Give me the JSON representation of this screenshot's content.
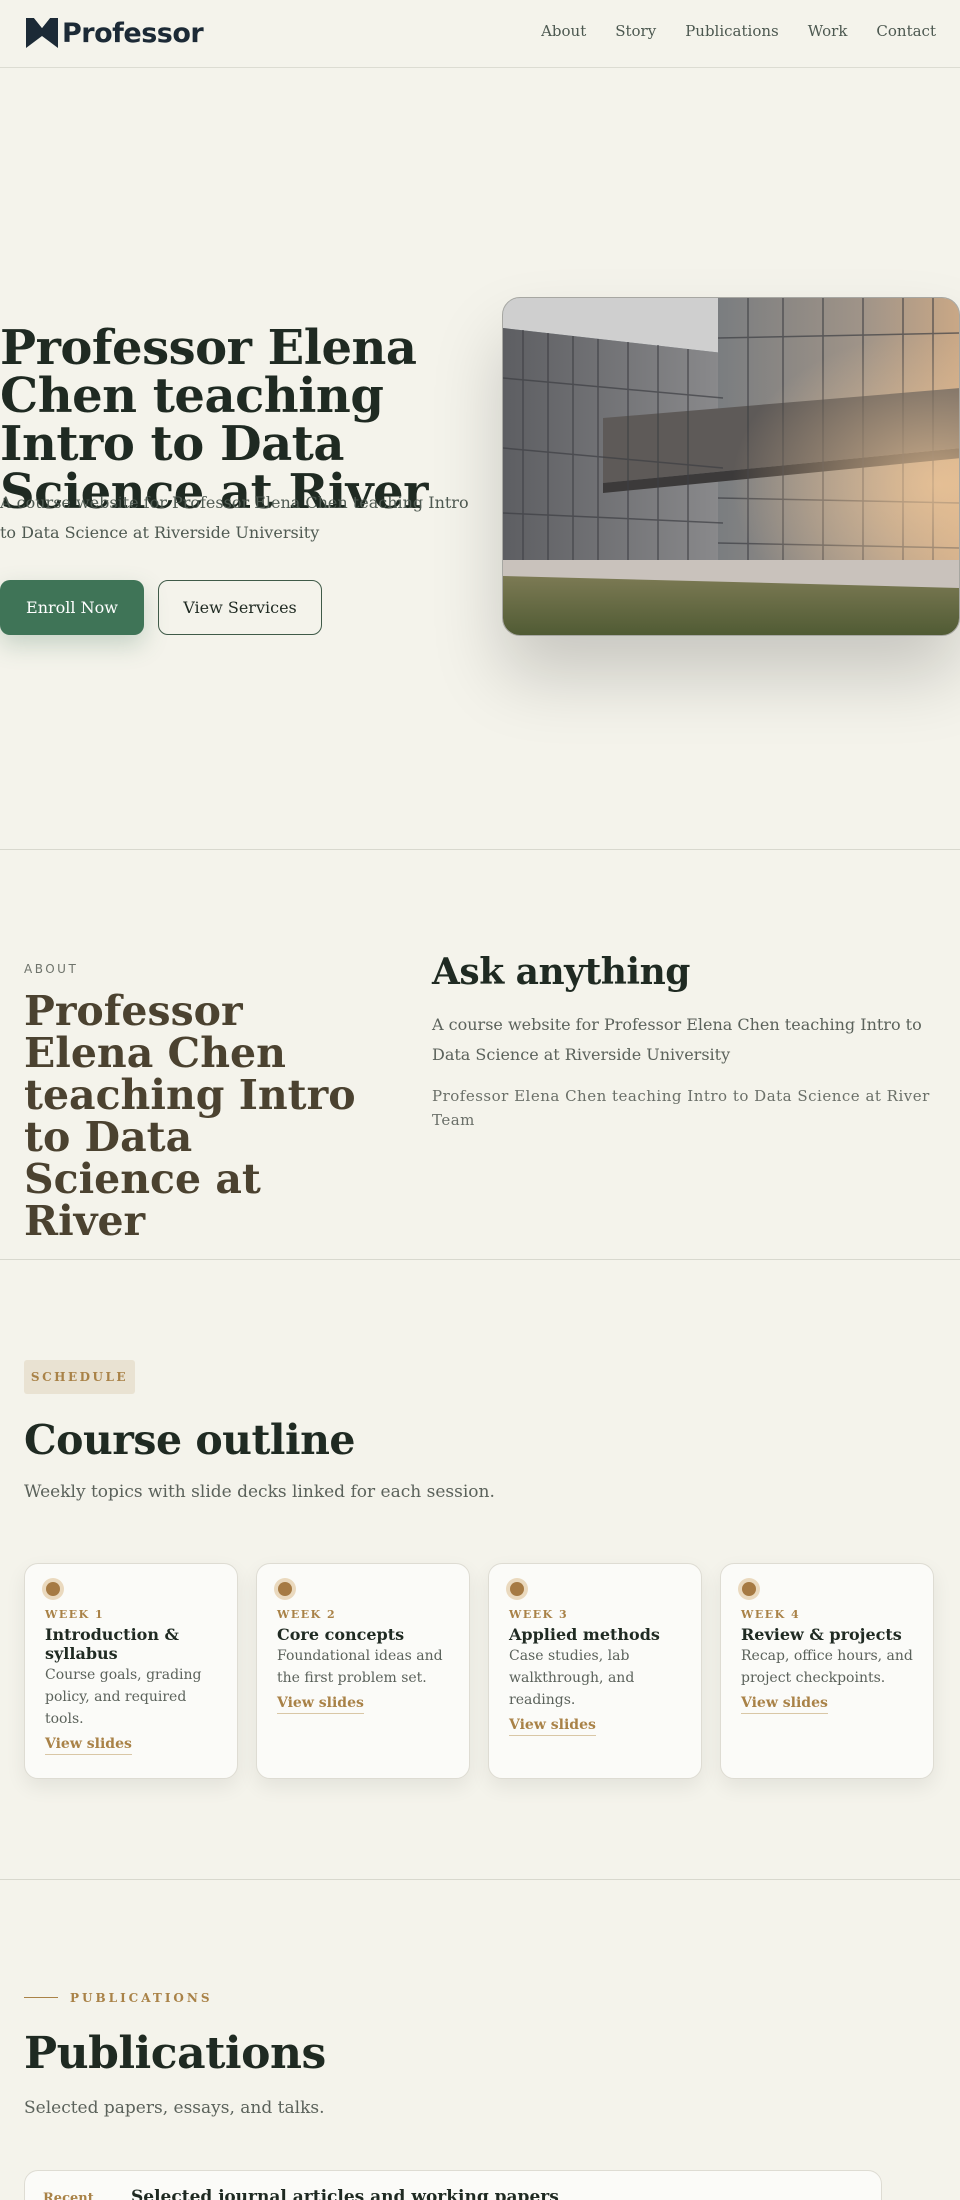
{
  "brand": {
    "name": "Professor",
    "accent": "#3f7457",
    "gold": "#a98247",
    "logo_color": "#1c2a36"
  },
  "nav": {
    "links": [
      "About",
      "Story",
      "Publications",
      "Work",
      "Contact"
    ]
  },
  "hero": {
    "title": "Professor Elena Chen teaching Intro to Data Science at River",
    "subtitle": "A course website for Professor Elena Chen teaching Intro to Data Science at Riverside University",
    "primary_button": "Enroll Now",
    "secondary_button": "View Services",
    "image_icon": "modern-building-photo"
  },
  "about": {
    "eyebrow": "ABOUT",
    "title": "Professor Elena Chen teaching Intro to Data Science at River",
    "ask_title": "Ask anything",
    "ask_text": "A course website for Professor Elena Chen teaching Intro to Data Science at Riverside University",
    "team": "Professor Elena Chen teaching Intro to Data Science at River Team"
  },
  "schedule": {
    "badge": "SCHEDULE",
    "title": "Course outline",
    "subtitle": "Weekly topics with slide decks linked for each session.",
    "cards": [
      {
        "week": "WEEK 1",
        "title": "Introduction & syllabus",
        "desc": "Course goals, grading policy, and required tools.",
        "link": "View slides"
      },
      {
        "week": "WEEK 2",
        "title": "Core concepts",
        "desc": "Foundational ideas and the first problem set.",
        "link": "View slides"
      },
      {
        "week": "WEEK 3",
        "title": "Applied methods",
        "desc": "Case studies, lab walkthrough, and readings.",
        "link": "View slides"
      },
      {
        "week": "WEEK 4",
        "title": "Review & projects",
        "desc": "Recap, office hours, and project checkpoints.",
        "link": "View slides"
      }
    ]
  },
  "publications": {
    "eyebrow": "PUBLICATIONS",
    "title": "Publications",
    "subtitle": "Selected papers, essays, and talks.",
    "items": [
      {
        "tag": "Recent",
        "title": "Selected journal articles and working papers"
      }
    ]
  }
}
